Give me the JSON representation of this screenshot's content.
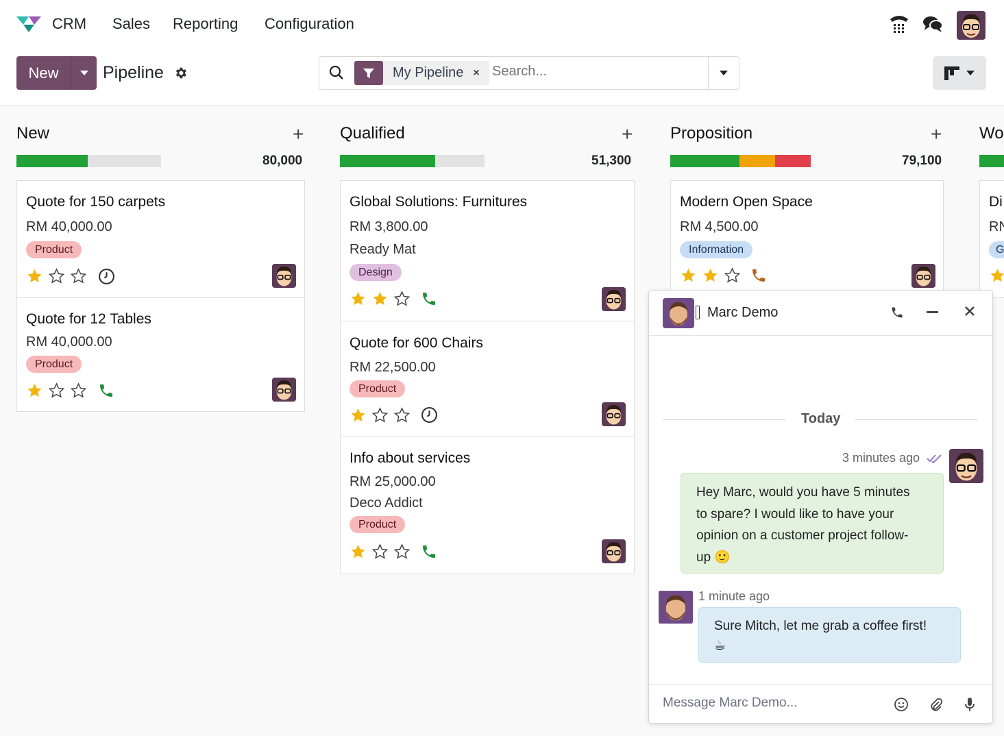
{
  "navbar": {
    "app_name": "CRM",
    "menu": [
      "Sales",
      "Reporting",
      "Configuration"
    ],
    "icons": [
      "phone-icon",
      "chat-icon",
      "user-avatar"
    ]
  },
  "control_panel": {
    "new_label": "New",
    "breadcrumb": "Pipeline",
    "facet_label": "My Pipeline",
    "facet_remove": "×",
    "search_placeholder": "Search..."
  },
  "columns": [
    {
      "title": "New",
      "total": "80,000",
      "progress": {
        "green": 0.49,
        "orange": 0,
        "red": 0
      },
      "cards": [
        {
          "title": "Quote for 150 carpets",
          "amount": "RM 40,000.00",
          "tag": "Product",
          "stars": 1,
          "activity": "clock"
        },
        {
          "title": "Quote for 12 Tables",
          "amount": "RM 40,000.00",
          "tag": "Product",
          "stars": 1,
          "activity": "phone"
        }
      ]
    },
    {
      "title": "Qualified",
      "total": "51,300",
      "progress": {
        "green": 0.66,
        "orange": 0,
        "red": 0
      },
      "cards": [
        {
          "title": "Global Solutions: Furnitures",
          "amount": "RM 3,800.00",
          "customer": "Ready Mat",
          "tag": "Design",
          "stars": 2,
          "activity": "phone"
        },
        {
          "title": "Quote for 600 Chairs",
          "amount": "RM 22,500.00",
          "tag": "Product",
          "stars": 1,
          "activity": "clock"
        },
        {
          "title": "Info about services",
          "amount": "RM 25,000.00",
          "customer": "Deco Addict",
          "tag": "Product",
          "stars": 1,
          "activity": "phone"
        }
      ]
    },
    {
      "title": "Proposition",
      "total": "79,100",
      "progress": {
        "green": 0.49,
        "orange": 0.25,
        "red": 0.26
      },
      "cards": [
        {
          "title": "Modern Open Space",
          "amount": "RM 4,500.00",
          "tag": "Information",
          "stars": 2,
          "activity": "phone-orange"
        }
      ]
    },
    {
      "title": "Wo",
      "cards": [
        {
          "title": "Di",
          "amount": "RN",
          "tag": "G"
        }
      ]
    }
  ],
  "chat": {
    "name": "Marc Demo",
    "separator": "Today",
    "messages": [
      {
        "time": "3 minutes ago",
        "text_lines": [
          "Hey Marc, would you have 5 minutes",
          "to spare? I would like to have your",
          "opinion on a customer project follow-",
          "up 🙂"
        ]
      },
      {
        "time": "1 minute ago",
        "text_lines": [
          "Sure Mitch, let me grab a coffee first!",
          "☕"
        ]
      }
    ],
    "composer_placeholder": "Message Marc Demo..."
  },
  "colors": {
    "brand": "#714b67",
    "green": "#21a138",
    "orange": "#f0a30a",
    "red": "#e0404a",
    "star": "#f3b50c"
  }
}
